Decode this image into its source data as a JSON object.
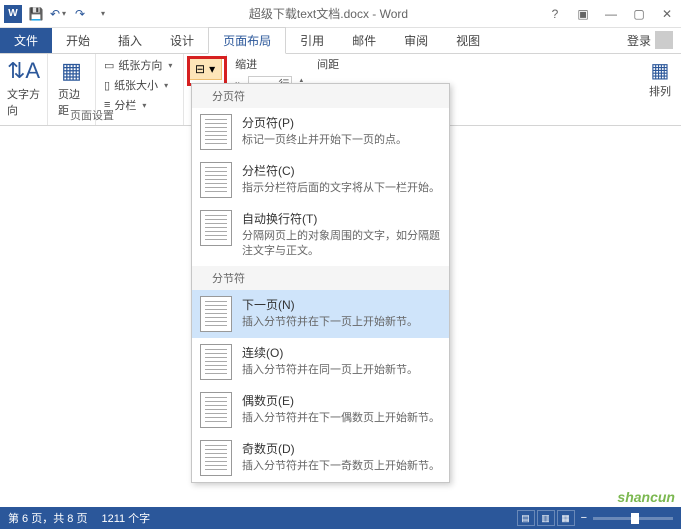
{
  "title": "超级下载text文档.docx - Word",
  "tabs": {
    "file": "文件",
    "home": "开始",
    "insert": "插入",
    "design": "设计",
    "layout": "页面布局",
    "ref": "引用",
    "mail": "邮件",
    "review": "审阅",
    "view": "视图",
    "login": "登录"
  },
  "ribbon": {
    "textdir": "文字方向",
    "margins": "页边距",
    "orient": "纸张方向",
    "size": "纸张大小",
    "columns": "分栏",
    "pagesetup": "页面设置",
    "indent": "缩进",
    "spacing": "间距",
    "arrange": "排列",
    "char_left": "行"
  },
  "dropdown": {
    "section1": "分页符",
    "items1": [
      {
        "t": "分页符(P)",
        "d": "标记一页终止并开始下一页的点。"
      },
      {
        "t": "分栏符(C)",
        "d": "指示分栏符后面的文字将从下一栏开始。"
      },
      {
        "t": "自动换行符(T)",
        "d": "分隔网页上的对象周围的文字，如分隔题注文字与正文。"
      }
    ],
    "section2": "分节符",
    "items2": [
      {
        "t": "下一页(N)",
        "d": "插入分节符并在下一页上开始新节。"
      },
      {
        "t": "连续(O)",
        "d": "插入分节符并在同一页上开始新节。"
      },
      {
        "t": "偶数页(E)",
        "d": "插入分节符并在下一偶数页上开始新节。"
      },
      {
        "t": "奇数页(D)",
        "d": "插入分节符并在下一奇数页上开始新节。"
      }
    ]
  },
  "status": {
    "page": "第 6 页，共 8 页",
    "words": "1211 个字"
  },
  "watermark": "shancun"
}
